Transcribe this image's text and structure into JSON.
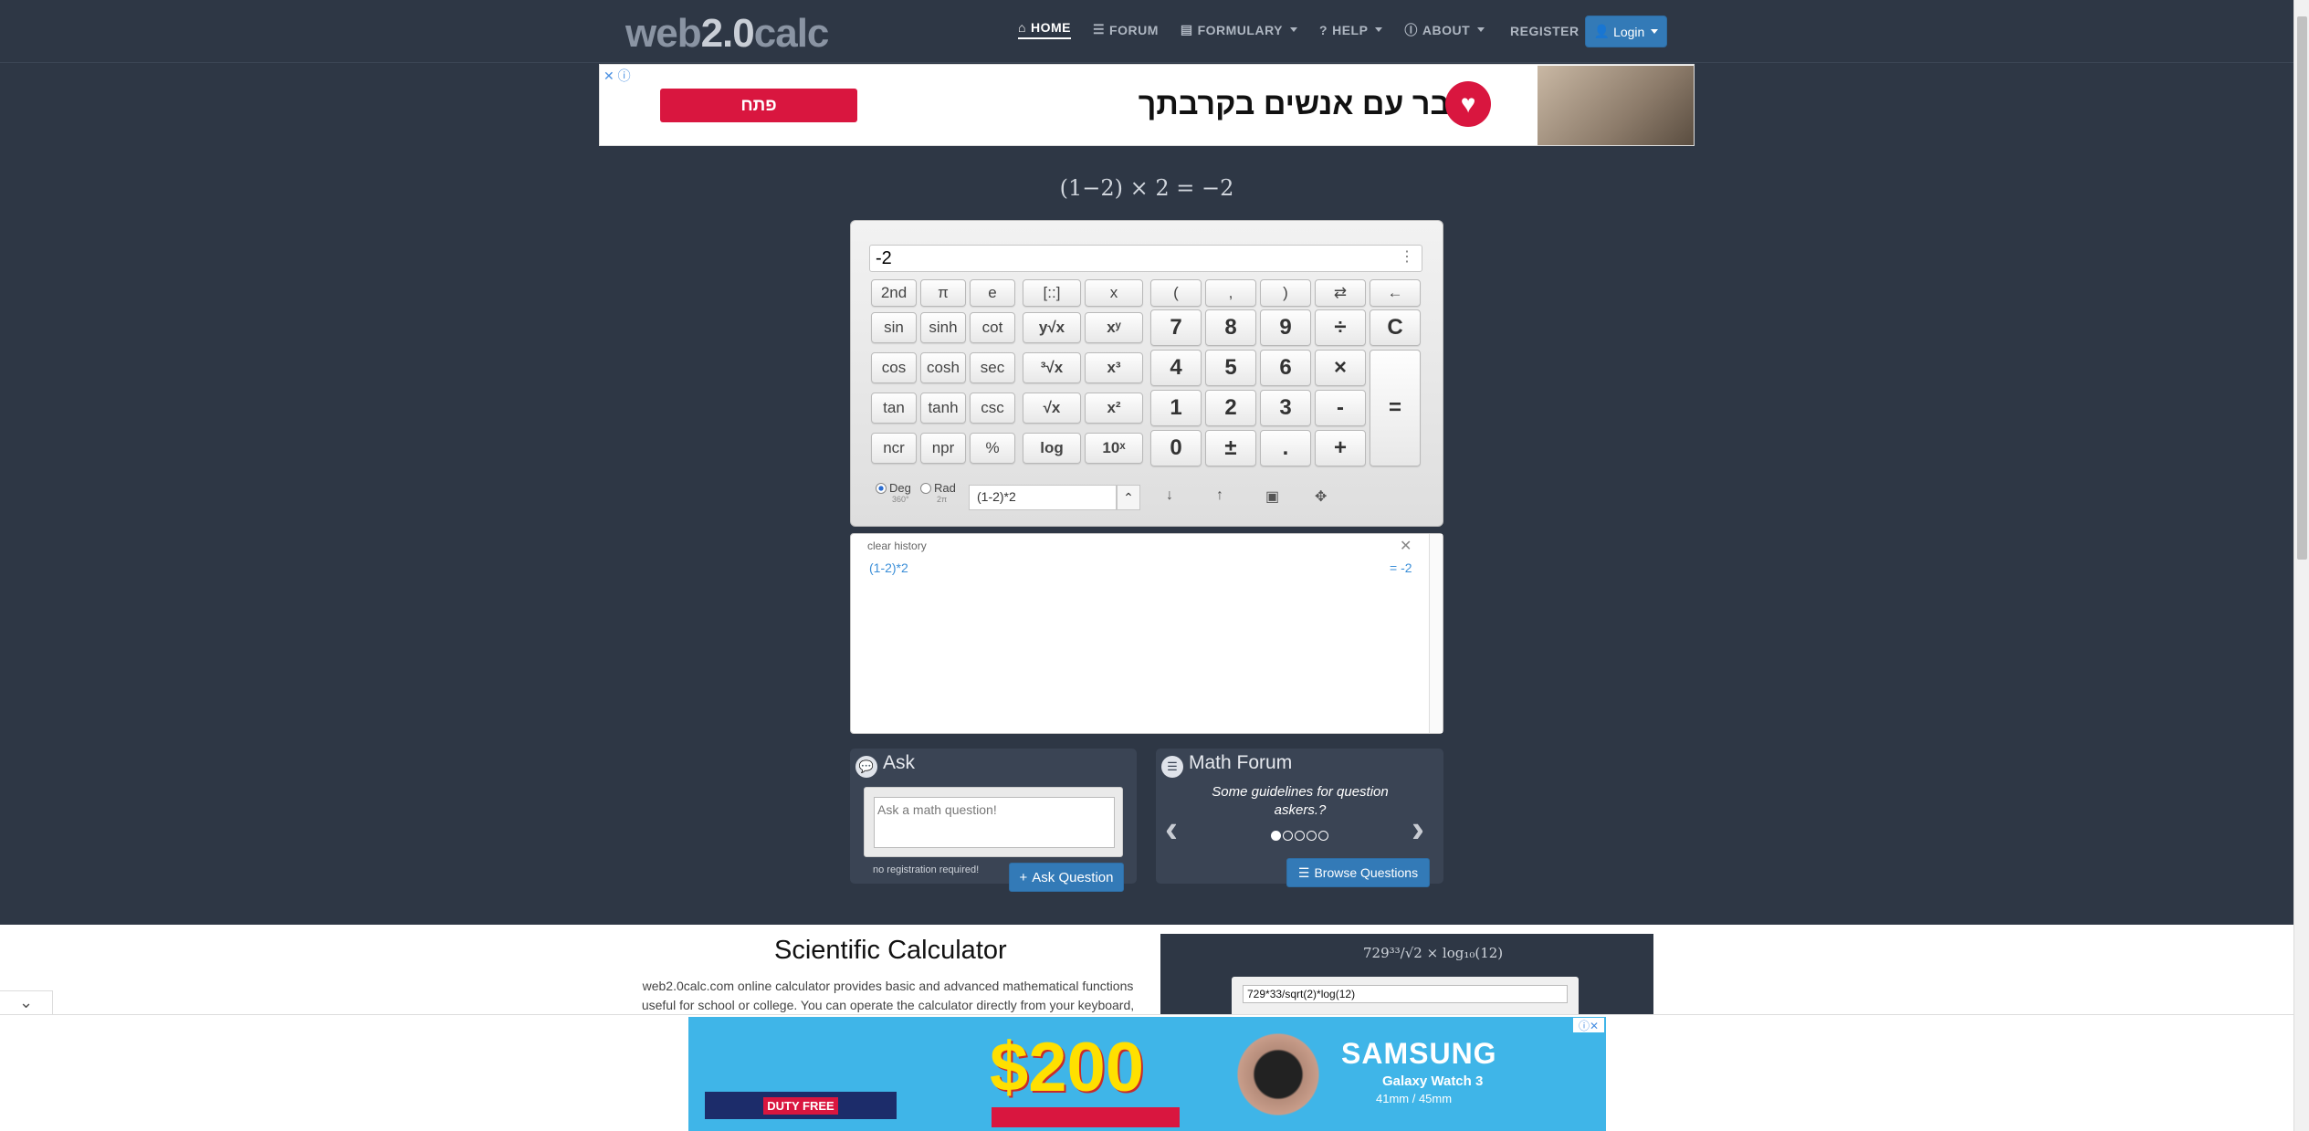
{
  "nav": {
    "logo_prefix": "web",
    "logo_mid": "2.0",
    "logo_suffix": "calc",
    "items": [
      {
        "label": "HOME",
        "icon": "home-icon"
      },
      {
        "label": "FORUM",
        "icon": "list-icon"
      },
      {
        "label": "FORMULARY",
        "icon": "book-icon"
      },
      {
        "label": "HELP",
        "icon": "question-icon"
      },
      {
        "label": "ABOUT",
        "icon": "info-icon"
      }
    ],
    "register": "REGISTER",
    "login": "Login"
  },
  "ad_top": {
    "button": "פתח",
    "headline": "דבר עם אנשים בקרבתך"
  },
  "equation": "(1−2) × 2 = −2",
  "calculator": {
    "display": "-2",
    "history_input": "(1-2)*2",
    "deg_label": "Deg",
    "deg_sub": "360°",
    "rad_label": "Rad",
    "rad_sub": "2π",
    "angle_mode": "Deg",
    "keys": {
      "second": "2nd",
      "pi": "π",
      "e": "e",
      "matrix": "[::]",
      "x": "x",
      "lparen": "(",
      "comma": ",",
      "rparen": ")",
      "swap": "⇄",
      "back": "←",
      "sin": "sin",
      "sinh": "sinh",
      "cot": "cot",
      "yroot": "y√x",
      "xpowy": "xʸ",
      "n7": "7",
      "n8": "8",
      "n9": "9",
      "div": "÷",
      "clear": "C",
      "cos": "cos",
      "cosh": "cosh",
      "sec": "sec",
      "cbrt": "³√x",
      "cube": "x³",
      "n4": "4",
      "n5": "5",
      "n6": "6",
      "mul": "×",
      "equals": "=",
      "tan": "tan",
      "tanh": "tanh",
      "csc": "csc",
      "sqrt": "√x",
      "square": "x²",
      "n1": "1",
      "n2": "2",
      "n3": "3",
      "minus": "-",
      "ncr": "ncr",
      "npr": "npr",
      "pct": "%",
      "log": "log",
      "tenpow": "10ˣ",
      "n0": "0",
      "plusminus": "±",
      "dot": ".",
      "plus": "+"
    }
  },
  "history": {
    "clear": "clear history",
    "entries": [
      {
        "expr": "(1-2)*2",
        "result": "= -2"
      }
    ]
  },
  "ask": {
    "title": "Ask",
    "placeholder": "Ask a math question!",
    "note": "no registration required!",
    "button": "Ask Question"
  },
  "forum": {
    "title": "Math Forum",
    "text": "Some guidelines for question askers.?",
    "button": "Browse Questions",
    "slide_active": 1,
    "slide_count": 5
  },
  "lower": {
    "title": "Scientific Calculator",
    "text": "web2.0calc.com online calculator provides basic and advanced mathematical functions useful for school or college. You can operate the calculator directly from your keyboard,",
    "demo_formula": "729³³/√2 × log₁₀(12)",
    "demo_input": "729*33/sqrt(2)*log(12)"
  },
  "ad_bottom": {
    "amount": "$200",
    "brand": "SAMSUNG",
    "product": "Galaxy Watch 3",
    "size": "41mm / 45mm",
    "duty_free": "DUTY FREE"
  }
}
